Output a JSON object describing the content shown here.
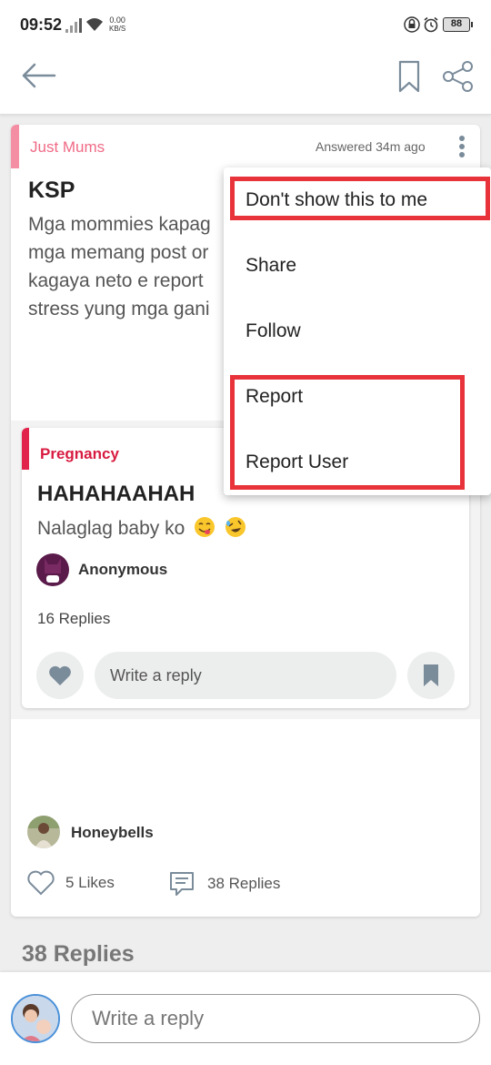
{
  "status_bar": {
    "time": "09:52",
    "net_speed_value": "0.00",
    "net_speed_unit": "KB/S",
    "battery": "88"
  },
  "post": {
    "category": "Just Mums",
    "meta": "Answered 34m ago",
    "title": "KSP",
    "body_lines": [
      "Mga mommies kapag",
      "mga memang post or",
      "kagaya neto e report",
      "stress yung mga gani"
    ],
    "author": "Honeybells",
    "likes": "5 Likes",
    "replies": "38 Replies"
  },
  "embedded_post": {
    "category": "Pregnancy",
    "title": "HAHAHAAHAH",
    "body": "Nalaglag baby ko",
    "author": "Anonymous",
    "replies": "16 Replies",
    "reply_placeholder": "Write a reply"
  },
  "replies_heading": "38 Replies",
  "reply_bar": {
    "placeholder": "Write a reply"
  },
  "menu": {
    "items": [
      "Don't show this to me",
      "Share",
      "Follow",
      "Report",
      "Report User"
    ]
  },
  "colors": {
    "accent_pink": "#f06a86",
    "accent_red": "#d81b40",
    "highlight": "#e8333a"
  }
}
